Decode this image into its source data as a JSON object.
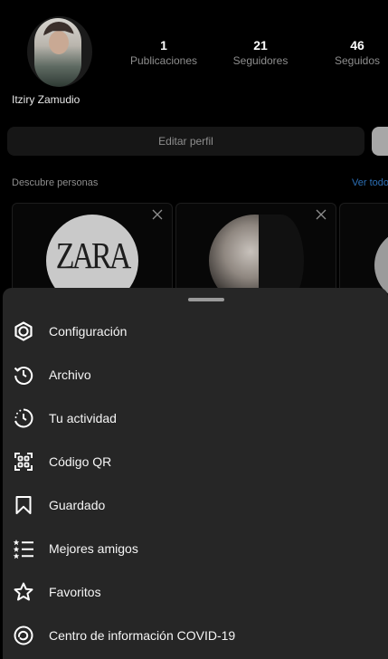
{
  "profile": {
    "username": "Itziry Zamudio",
    "stats": [
      {
        "num": "1",
        "label": "Publicaciones"
      },
      {
        "num": "21",
        "label": "Seguidores"
      },
      {
        "num": "46",
        "label": "Seguidos"
      }
    ],
    "edit_label": "Editar perfil"
  },
  "discover": {
    "title": "Descubre personas",
    "see_all": "Ver todo",
    "cards": [
      {
        "name": "ZARA",
        "icon": "zara-logo"
      },
      {
        "icon": "woman-portrait"
      },
      {
        "icon": "partial-profile"
      }
    ]
  },
  "menu": {
    "items": [
      {
        "label": "Configuración",
        "icon": "settings-icon"
      },
      {
        "label": "Archivo",
        "icon": "archive-icon"
      },
      {
        "label": "Tu actividad",
        "icon": "activity-icon"
      },
      {
        "label": "Código QR",
        "icon": "qr-code-icon"
      },
      {
        "label": "Guardado",
        "icon": "bookmark-icon"
      },
      {
        "label": "Mejores amigos",
        "icon": "close-friends-icon"
      },
      {
        "label": "Favoritos",
        "icon": "star-icon"
      },
      {
        "label": "Centro de información COVID-19",
        "icon": "covid-info-icon"
      }
    ]
  },
  "colors": {
    "background": "#000000",
    "sheet": "#262626",
    "muted_text": "#8e8e8e",
    "link": "#2c6fb5"
  }
}
